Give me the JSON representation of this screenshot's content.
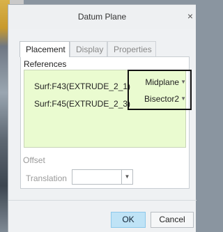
{
  "dialog": {
    "title": "Datum Plane",
    "close_glyph": "×"
  },
  "tabs": [
    {
      "label": "Placement",
      "active": true
    },
    {
      "label": "Display",
      "active": false
    },
    {
      "label": "Properties",
      "active": false
    }
  ],
  "references": {
    "label": "References",
    "rows": [
      {
        "name": "Surf:F43(EXTRUDE_2_1)",
        "constraint": "Midplane"
      },
      {
        "name": "Surf:F45(EXTRUDE_2_3)",
        "constraint": "Bisector2"
      }
    ],
    "dropdown_glyph": "▼"
  },
  "offset": {
    "label": "Offset",
    "translation_label": "Translation",
    "translation_value": "",
    "dropdown_glyph": "▼"
  },
  "buttons": {
    "ok": "OK",
    "cancel": "Cancel"
  },
  "colors": {
    "references_bg": "#eafbd0",
    "ok_bg": "#bfe3f6"
  }
}
